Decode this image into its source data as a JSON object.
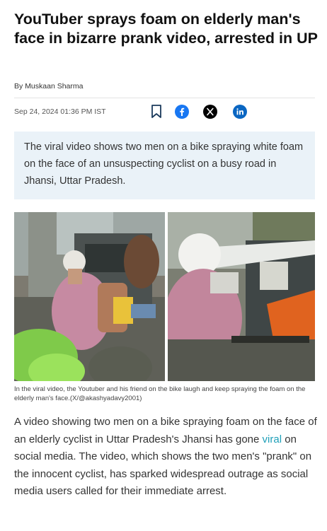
{
  "article": {
    "title": "YouTuber sprays foam on elderly man's face in bizarre prank video, arrested in UP",
    "byline_prefix": "By",
    "author": "Muskaan Sharma",
    "date": "Sep 24, 2024 01:36 PM IST",
    "summary": "The viral video shows two men on a bike spraying white foam on the face of an unsuspecting cyclist on a busy road in Jhansi, Uttar Pradesh.",
    "image_caption": "In the viral video, the Youtuber and his friend on the bike laugh and keep spraying the foam on the elderly man's face.(X/@akashyadavy2001)",
    "body": {
      "before_link": "A video showing two men on a bike spraying foam on the face of an elderly cyclist in Uttar Pradesh's Jhansi has gone ",
      "link": "viral",
      "after_link": " on social media. The video, which shows the two men's \"prank\" on the innocent cyclist, has sparked widespread outrage as social media users called for their immediate arrest."
    }
  },
  "share": {
    "bookmark": "bookmark-icon",
    "facebook": "facebook-icon",
    "x": "x-icon",
    "linkedin": "linkedin-icon"
  },
  "colors": {
    "facebook": "#1877f2",
    "x": "#000000",
    "linkedin": "#0a66c2",
    "link": "#1e9fb8",
    "summary_bg": "#eaf2f8"
  }
}
